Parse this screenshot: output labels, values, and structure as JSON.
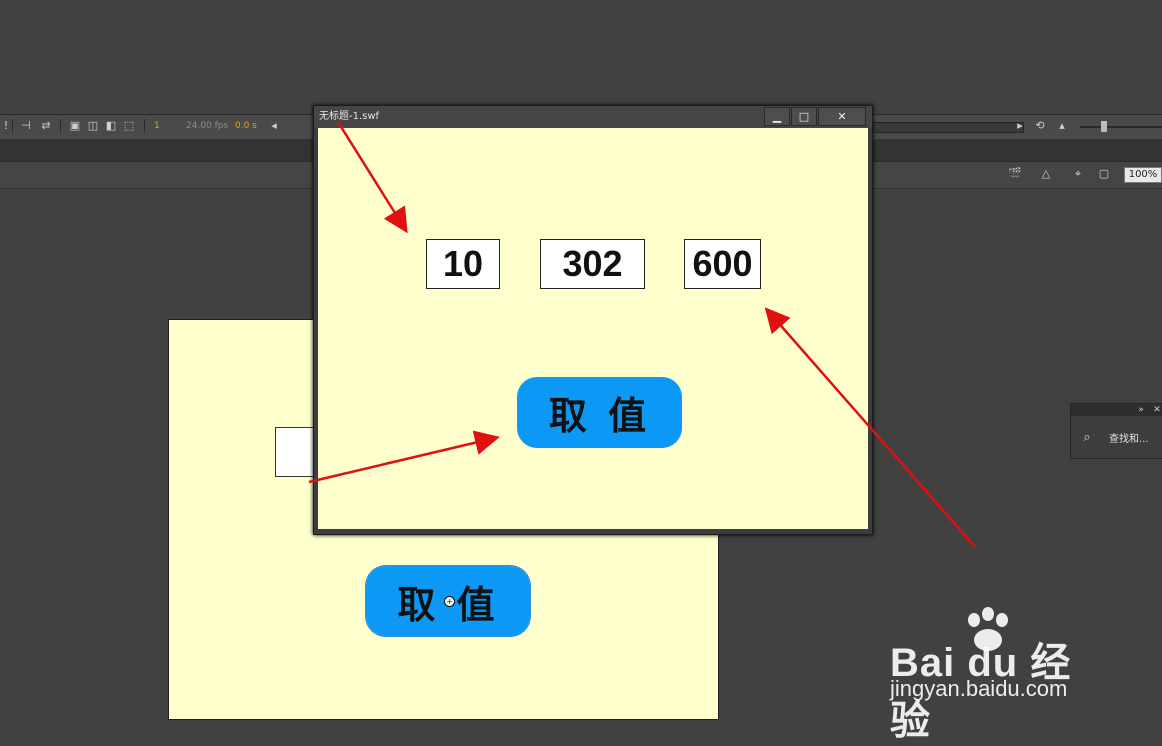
{
  "timeline": {
    "frame": "1",
    "fps": "24.00 fps",
    "time": "0.0 s",
    "colors": {
      "frame": "#e0a400",
      "fps": "#8a8a8a",
      "time": "#e0a400"
    }
  },
  "editbar": {
    "zoom": "100%"
  },
  "stage": {
    "button_label": "取 值",
    "background": "#ffffcd"
  },
  "swf_window": {
    "title": "无标题-1.swf",
    "controls": {
      "minimize": "▁",
      "maximize": "□",
      "close": "✕"
    },
    "fields": [
      "10",
      "302",
      "600"
    ],
    "button_label": "取 值",
    "button_color": "#0c99f5"
  },
  "find_panel": {
    "label": "查找和..."
  },
  "annotations": {
    "arrow_color": "#e01010"
  },
  "watermark": {
    "brand": "Bai du 经验",
    "sub": "jingyan.baidu.com"
  }
}
